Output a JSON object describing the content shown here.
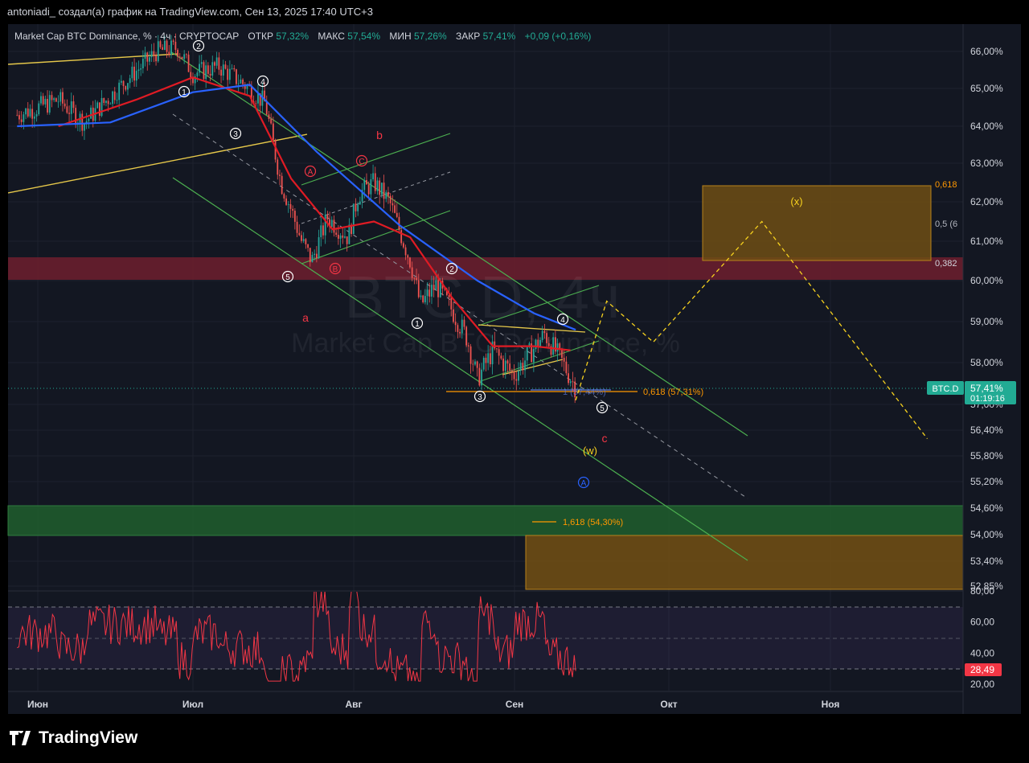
{
  "header": {
    "author_line": "antoniadi_ создал(а) график на TradingView.com, Сен 13, 2025 17:40 UTC+3"
  },
  "legend": {
    "symbol": "Market Cap BTC Dominance, % · 4ч · CRYPTOCAP",
    "open_label": "ОТКР",
    "open_value": "57,32%",
    "high_label": "МАКС",
    "high_value": "57,54%",
    "low_label": "МИН",
    "low_value": "57,26%",
    "close_label": "ЗАКР",
    "close_value": "57,41%",
    "change": "+0,09 (+0,16%)"
  },
  "watermark": {
    "line1": "BTC.D, 4ч",
    "line2": "Market Cap BTC Dominance, %"
  },
  "price_badge": {
    "ticker": "BTC.D",
    "value": "57,41%",
    "countdown": "01:19:16"
  },
  "rsi_badge": "28,49",
  "fib_labels": {
    "f0618_top": "0,618",
    "f05": "0,5 (6",
    "f0382": "0,382",
    "f0618_bottom": "0,618 (57,31%)",
    "f1618": "1,618 (54,30%)",
    "f1_partial": "1 (57,44%)"
  },
  "wave_labels": {
    "a": "a",
    "b": "b",
    "c": "c",
    "A": "A",
    "B": "B",
    "C": "C",
    "w": "(w)",
    "x": "(x)",
    "blueA": "A",
    "n1": "1",
    "n2": "2",
    "n3": "3",
    "n4": "4",
    "n5": "5"
  },
  "logo_text": "TradingView",
  "colors": {
    "background": "#131722",
    "grid": "#1e222d",
    "up_candle": "#26a69a",
    "down_candle": "#ef5350",
    "ma_red": "#e01b24",
    "ma_blue": "#2962ff",
    "channel_green": "#4caf50",
    "trend_yellow": "#e6c84a",
    "projection_yellow": "#f7d21e",
    "resistance_zone": "#6e1f2e",
    "target_zone_orange": "#6e4d14",
    "support_zone_green": "#1f5a2c",
    "rsi_line": "#f23645",
    "price_badge": "#22ab94"
  },
  "chart_data": {
    "type": "candlestick",
    "title": "Market Cap BTC Dominance, %",
    "timeframe": "4ч",
    "x_axis": {
      "labels": [
        "Июн",
        "Июл",
        "Авг",
        "Сен",
        "Окт",
        "Ноя"
      ],
      "range": [
        "2025-05-28",
        "2025-11-20"
      ]
    },
    "y_axis": {
      "unit": "%",
      "ticks": [
        "66,00%",
        "65,00%",
        "64,00%",
        "63,00%",
        "62,00%",
        "61,00%",
        "60,00%",
        "59,00%",
        "58,00%",
        "57,00%",
        "56,40%",
        "55,80%",
        "55,20%",
        "54,60%",
        "54,00%",
        "53,40%",
        "52,85%"
      ],
      "range": [
        52.85,
        66.4
      ]
    },
    "price_path": [
      [
        "2025-05-28",
        64.3
      ],
      [
        "2025-06-05",
        64.7
      ],
      [
        "2025-06-10",
        64.1
      ],
      [
        "2025-06-18",
        65.2
      ],
      [
        "2025-06-24",
        66.0
      ],
      [
        "2025-06-28",
        66.1
      ],
      [
        "2025-07-01",
        65.4
      ],
      [
        "2025-07-06",
        65.6
      ],
      [
        "2025-07-11",
        65.1
      ],
      [
        "2025-07-15",
        64.6
      ],
      [
        "2025-07-18",
        62.5
      ],
      [
        "2025-07-20",
        61.8
      ],
      [
        "2025-07-22",
        61.0
      ],
      [
        "2025-07-24",
        60.5
      ],
      [
        "2025-07-27",
        61.6
      ],
      [
        "2025-07-31",
        61.1
      ],
      [
        "2025-08-02",
        62.2
      ],
      [
        "2025-08-05",
        62.5
      ],
      [
        "2025-08-08",
        62.0
      ],
      [
        "2025-08-12",
        60.5
      ],
      [
        "2025-08-14",
        59.4
      ],
      [
        "2025-08-17",
        59.9
      ],
      [
        "2025-08-20",
        59.3
      ],
      [
        "2025-08-23",
        58.6
      ],
      [
        "2025-08-25",
        57.6
      ],
      [
        "2025-08-28",
        58.3
      ],
      [
        "2025-09-01",
        57.7
      ],
      [
        "2025-09-04",
        58.2
      ],
      [
        "2025-09-07",
        58.7
      ],
      [
        "2025-09-10",
        58.1
      ],
      [
        "2025-09-13",
        57.41
      ]
    ],
    "moving_averages": [
      {
        "color": "red",
        "path": [
          [
            "2025-06-05",
            64.0
          ],
          [
            "2025-06-20",
            64.7
          ],
          [
            "2025-07-01",
            65.3
          ],
          [
            "2025-07-12",
            64.8
          ],
          [
            "2025-07-20",
            62.6
          ],
          [
            "2025-07-28",
            61.3
          ],
          [
            "2025-08-05",
            61.5
          ],
          [
            "2025-08-12",
            61.1
          ],
          [
            "2025-08-20",
            59.6
          ],
          [
            "2025-08-28",
            58.4
          ],
          [
            "2025-09-05",
            58.4
          ],
          [
            "2025-09-12",
            58.3
          ]
        ]
      },
      {
        "color": "blue",
        "path": [
          [
            "2025-05-28",
            64.0
          ],
          [
            "2025-06-15",
            64.1
          ],
          [
            "2025-07-01",
            64.9
          ],
          [
            "2025-07-12",
            65.1
          ],
          [
            "2025-07-25",
            63.3
          ],
          [
            "2025-08-10",
            61.4
          ],
          [
            "2025-08-25",
            60.0
          ],
          [
            "2025-09-05",
            59.2
          ],
          [
            "2025-09-13",
            58.8
          ]
        ]
      }
    ],
    "zones": [
      {
        "name": "resistance",
        "y_from": 60.0,
        "y_to": 60.5
      },
      {
        "name": "target-x",
        "y_from": 60.5,
        "y_to": 62.3
      },
      {
        "name": "support-green",
        "y_from": 53.9,
        "y_to": 54.6
      },
      {
        "name": "target-low",
        "y_from": 52.85,
        "y_to": 53.9
      }
    ],
    "projection": [
      [
        "2025-09-13",
        57.1
      ],
      [
        "2025-09-19",
        59.5
      ],
      [
        "2025-09-28",
        58.5
      ],
      [
        "2025-10-19",
        61.5
      ],
      [
        "2025-11-20",
        56.2
      ]
    ],
    "rsi": {
      "ticks": [
        "80,00",
        "60,00",
        "40,00",
        "20,00"
      ],
      "range": [
        20,
        80
      ],
      "current": 28.49
    }
  }
}
